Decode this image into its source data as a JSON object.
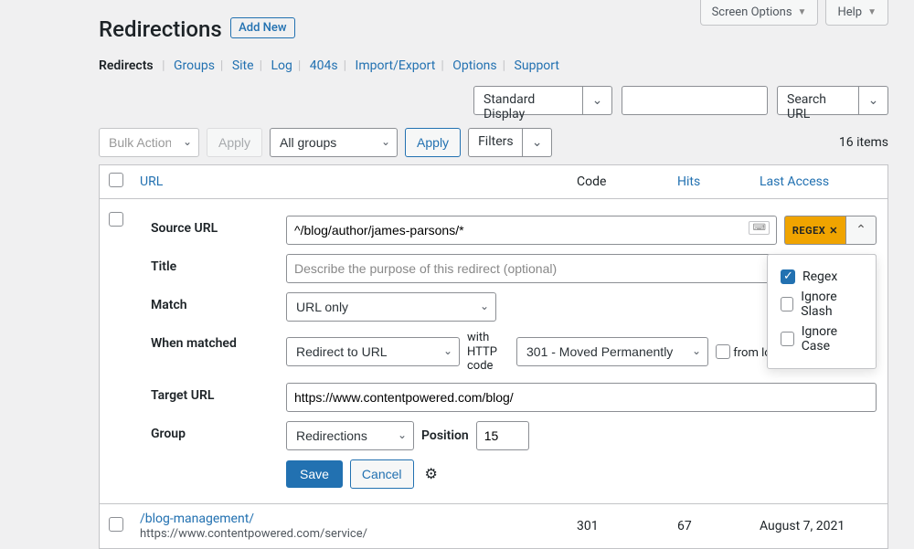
{
  "top_tabs": {
    "screen_options": "Screen Options",
    "help": "Help"
  },
  "page": {
    "title": "Redirections",
    "add_new": "Add New"
  },
  "nav": {
    "current": "Redirects",
    "links": [
      "Groups",
      "Site",
      "Log",
      "404s",
      "Import/Export",
      "Options",
      "Support"
    ]
  },
  "row2": {
    "display_mode": "Standard Display",
    "search_btn": "Search URL"
  },
  "row3": {
    "bulk": "Bulk Actions",
    "apply": "Apply",
    "groups": "All groups",
    "apply2": "Apply",
    "filters": "Filters",
    "count": "16 items"
  },
  "cols": {
    "url": "URL",
    "code": "Code",
    "hits": "Hits",
    "last": "Last Access"
  },
  "edit": {
    "source_lbl": "Source URL",
    "source_val": "^/blog/author/james-parsons/*",
    "title_lbl": "Title",
    "title_ph": "Describe the purpose of this redirect (optional)",
    "match_lbl": "Match",
    "match_val": "URL only",
    "when_lbl": "When matched",
    "when_val": "Redirect to URL",
    "withcode": "with HTTP code",
    "http_val": "301 - Moved Permanently",
    "fromlogs": "from logs",
    "target_lbl": "Target URL",
    "target_val": "https://www.contentpowered.com/blog/",
    "group_lbl": "Group",
    "group_val": "Redirections",
    "pos_lbl": "Position",
    "pos_val": "15",
    "save": "Save",
    "cancel": "Cancel",
    "regex_badge": "Regex",
    "opts": {
      "regex": "Regex",
      "ignore_slash": "Ignore Slash",
      "ignore_case": "Ignore Case"
    }
  },
  "rows": [
    {
      "url": "/blog-management/",
      "dest": "https://www.contentpowered.com/service/",
      "code": "301",
      "hits": "67",
      "last": "August 7, 2021"
    }
  ]
}
